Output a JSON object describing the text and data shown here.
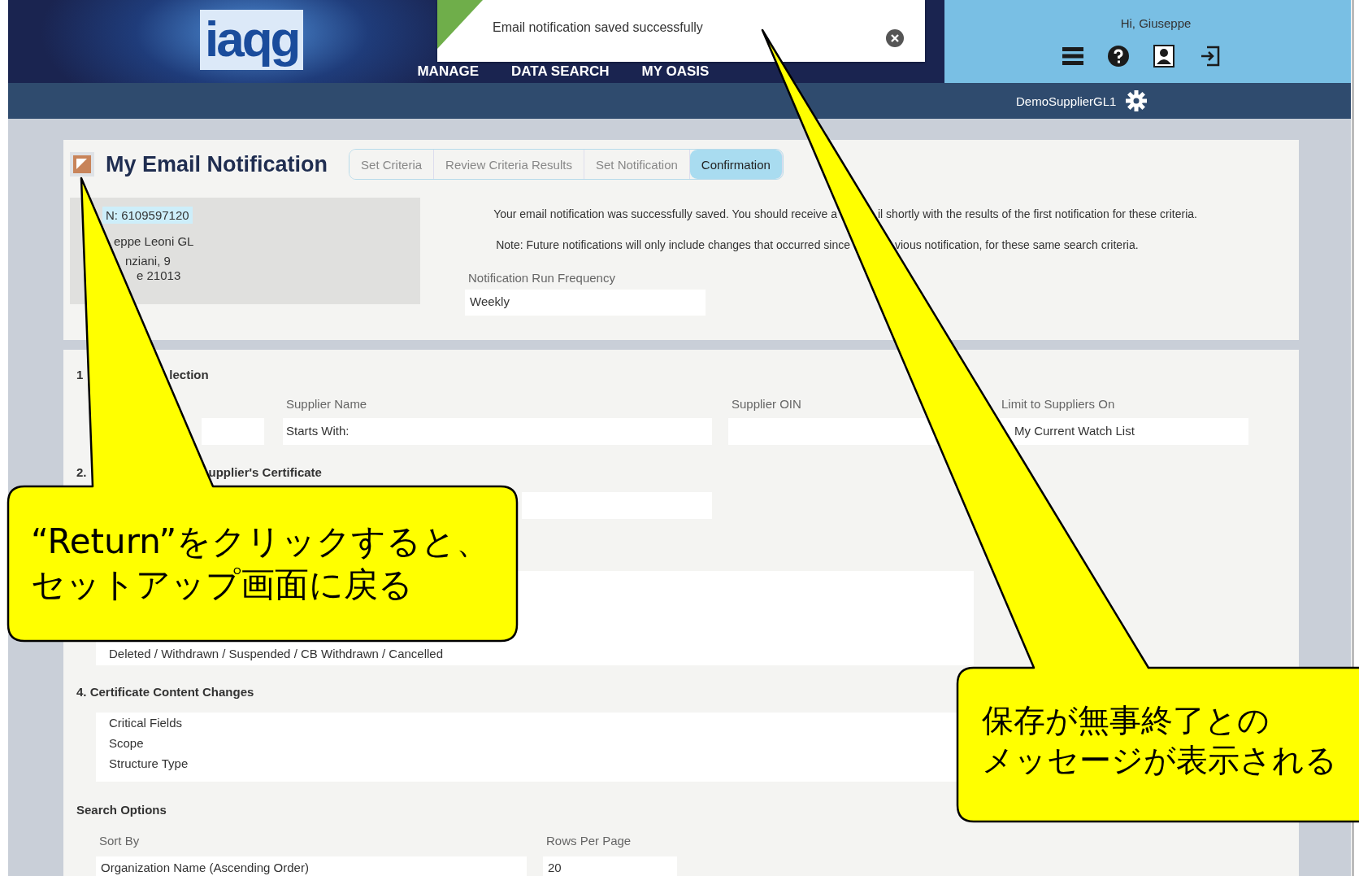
{
  "header": {
    "logo": "iaqg",
    "nav": [
      {
        "label": "MANAGE"
      },
      {
        "label": "DATA SEARCH"
      },
      {
        "label": "MY OASIS"
      }
    ],
    "greeting": "Hi, Giuseppe",
    "account": "DemoSupplierGL1"
  },
  "toast": {
    "message": "Email notification saved successfully"
  },
  "page_title": "My Email Notification",
  "tabs": [
    {
      "label": "Set Criteria",
      "selected": false
    },
    {
      "label": "Review Criteria Results",
      "selected": false
    },
    {
      "label": "Set Notification",
      "selected": false
    },
    {
      "label": "Confirmation",
      "selected": true
    }
  ],
  "supplier_card": {
    "lines": [
      "N: 6109597120",
      "eppe Leoni GL",
      "nziani, 9",
      "e 21013"
    ]
  },
  "confirmation": {
    "message": [
      "Your email notification was successfully saved. You should receive a",
      "il shortly with the results of the first notification for these criteria."
    ],
    "note": [
      "Note: Future notifications will only include changes that occurred since",
      "vious notification, for these same search criteria."
    ],
    "frequency": {
      "label": "Notification Run Frequency",
      "value": "Weekly"
    }
  },
  "section_1": {
    "heading": [
      "1",
      "lection"
    ],
    "fields": [
      {
        "label": "Supplier Name",
        "value": "Starts With:"
      },
      {
        "label": "Supplier OIN"
      },
      {
        "label": "Limit to Suppliers On",
        "value": "My Current Watch List"
      }
    ]
  },
  "section_2": {
    "heading": [
      "2.",
      "upplier's Certificate"
    ]
  },
  "section_3": {
    "lines": [
      "Deleted / Withdrawn / Suspended / CB Withdrawn / Cancelled"
    ]
  },
  "section_4": {
    "heading": "4. Certificate Content Changes",
    "lines": [
      "Critical Fields",
      "Scope",
      "Structure Type"
    ]
  },
  "search_options": {
    "heading": "Search Options",
    "sort_by": {
      "label": "Sort By",
      "value": "Organization Name (Ascending Order)"
    },
    "rows_per_page": {
      "label": "Rows Per Page",
      "value": "20"
    }
  },
  "callouts": [
    {
      "lines": [
        "“Return”をクリックすると、",
        "セットアップ画面に戻る"
      ]
    },
    {
      "lines": [
        "保存が無事終了との",
        "メッセージが表示される"
      ]
    }
  ]
}
